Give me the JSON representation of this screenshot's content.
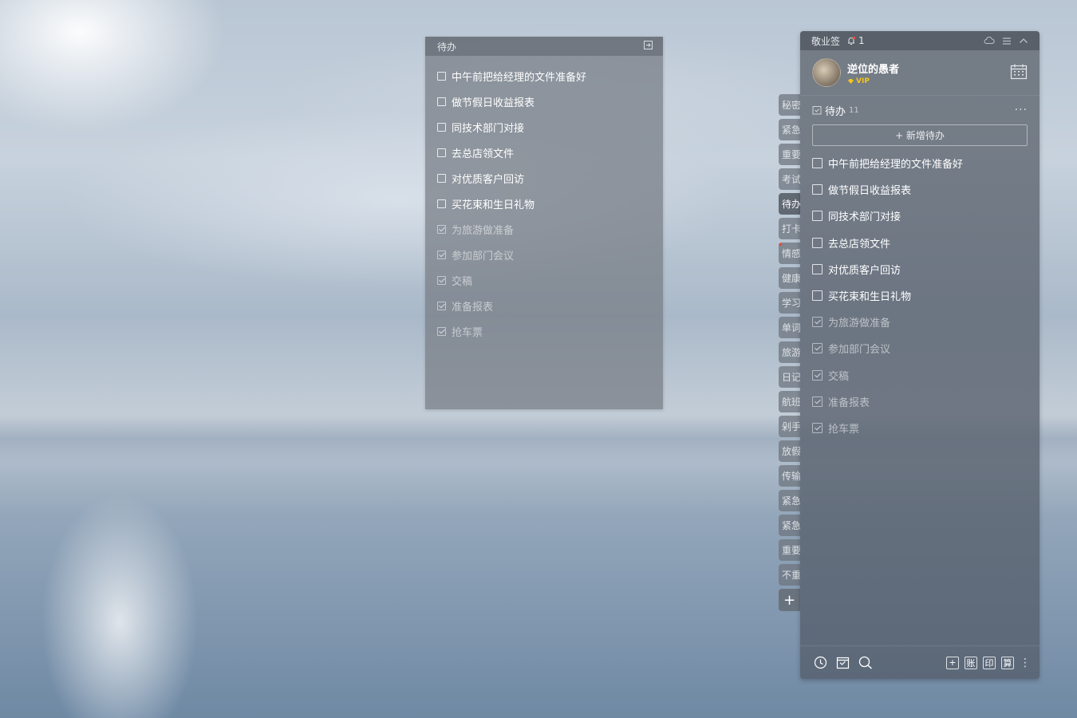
{
  "note": {
    "title": "待办",
    "items": [
      {
        "label": "中午前把给经理的文件准备好",
        "done": false
      },
      {
        "label": "做节假日收益报表",
        "done": false
      },
      {
        "label": "同技术部门对接",
        "done": false
      },
      {
        "label": "去总店领文件",
        "done": false
      },
      {
        "label": "对优质客户回访",
        "done": false
      },
      {
        "label": "买花束和生日礼物",
        "done": false
      },
      {
        "label": "为旅游做准备",
        "done": true
      },
      {
        "label": "参加部门会议",
        "done": true
      },
      {
        "label": "交稿",
        "done": true
      },
      {
        "label": "准备报表",
        "done": true
      },
      {
        "label": "抢车票",
        "done": true
      }
    ]
  },
  "tabs": [
    {
      "label": "秘密",
      "active": false
    },
    {
      "label": "紧急",
      "active": false
    },
    {
      "label": "重要",
      "active": false
    },
    {
      "label": "考试",
      "active": false
    },
    {
      "label": "待办",
      "active": true
    },
    {
      "label": "打卡",
      "active": false
    },
    {
      "label": "情感",
      "active": false,
      "dot": true
    },
    {
      "label": "健康",
      "active": false
    },
    {
      "label": "学习",
      "active": false
    },
    {
      "label": "单词",
      "active": false
    },
    {
      "label": "旅游",
      "active": false
    },
    {
      "label": "日记",
      "active": false
    },
    {
      "label": "航班",
      "active": false
    },
    {
      "label": "剁手",
      "active": false
    },
    {
      "label": "放假",
      "active": false
    },
    {
      "label": "传输",
      "active": false
    },
    {
      "label": "紧急",
      "active": false
    },
    {
      "label": "紧急",
      "active": false
    },
    {
      "label": "重要",
      "active": false
    },
    {
      "label": "不重",
      "active": false
    }
  ],
  "tab_add": "+",
  "panel": {
    "app_title": "敬业签",
    "notification_count": "1",
    "user": {
      "name": "逆位的愚者",
      "badge": "VIP"
    },
    "section": {
      "title": "待办",
      "count": "11",
      "more": "···"
    },
    "add_label": "+ 新增待办",
    "items": [
      {
        "label": "中午前把给经理的文件准备好",
        "done": false
      },
      {
        "label": "做节假日收益报表",
        "done": false
      },
      {
        "label": "同技术部门对接",
        "done": false
      },
      {
        "label": "去总店领文件",
        "done": false
      },
      {
        "label": "对优质客户回访",
        "done": false
      },
      {
        "label": "买花束和生日礼物",
        "done": false
      },
      {
        "label": "为旅游做准备",
        "done": true
      },
      {
        "label": "参加部门会议",
        "done": true
      },
      {
        "label": "交稿",
        "done": true
      },
      {
        "label": "准备报表",
        "done": true
      },
      {
        "label": "抢车票",
        "done": true
      }
    ],
    "footer": {
      "icons": [
        "clock-icon",
        "calendar-check-icon",
        "search-icon"
      ],
      "add_box": "+",
      "ledger": "账",
      "print": "印",
      "calc": "算",
      "more": "⋮"
    }
  },
  "colors": {
    "vip_gold": "#f5c518",
    "dot_red": "#e24b3c"
  }
}
